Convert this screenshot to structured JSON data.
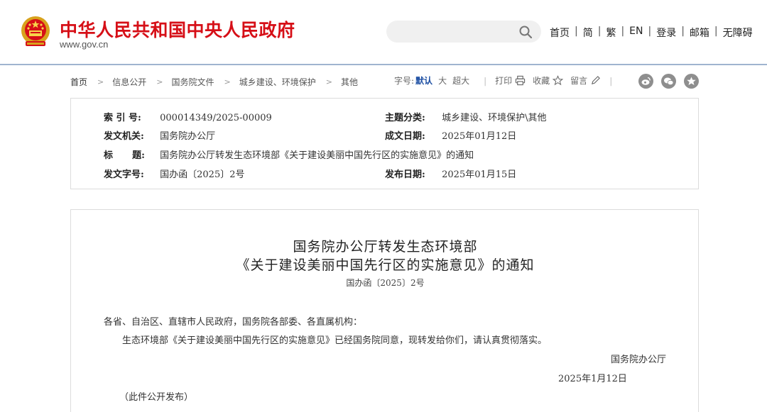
{
  "header": {
    "site_title": "中华人民共和国中央人民政府",
    "site_domain": "www.gov.cn",
    "search_placeholder": "",
    "nav": [
      "首页",
      "简",
      "繁",
      "EN",
      "登录",
      "邮箱",
      "无障碍"
    ]
  },
  "breadcrumb": [
    "首页",
    "信息公开",
    "国务院文件",
    "城乡建设、环境保护",
    "其他"
  ],
  "tools": {
    "font_size_label": "字号:",
    "font_sizes": [
      "默认",
      "大",
      "超大"
    ],
    "print": "打印",
    "favorite": "收藏",
    "comment": "留言"
  },
  "info": {
    "index_label": "索 引 号:",
    "index_value": "000014349/2025-00009",
    "category_label": "主题分类:",
    "category_value": "城乡建设、环境保护\\其他",
    "issuer_label": "发文机关:",
    "issuer_value": "国务院办公厅",
    "written_label": "成文日期:",
    "written_value": "2025年01月12日",
    "title_label": "标      题:",
    "title_value": "国务院办公厅转发生态环境部《关于建设美丽中国先行区的实施意见》的通知",
    "docno_label": "发文字号:",
    "docno_value": "国办函〔2025〕2号",
    "published_label": "发布日期:",
    "published_value": "2025年01月15日"
  },
  "article": {
    "title_line1": "国务院办公厅转发生态环境部",
    "title_line2": "《关于建设美丽中国先行区的实施意见》的通知",
    "doc_number": "国办函〔2025〕2号",
    "salutation": "各省、自治区、直辖市人民政府，国务院各部委、各直属机构：",
    "body": "生态环境部《关于建设美丽中国先行区的实施意见》已经国务院同意，现转发给你们，请认真贯彻落实。",
    "signer": "国务院办公厅",
    "date": "2025年1月12日",
    "note": "（此件公开发布）"
  },
  "colors": {
    "title_red": "#d60f17",
    "header_border": "#9fb4cf",
    "active_blue": "#1d4fa3"
  }
}
